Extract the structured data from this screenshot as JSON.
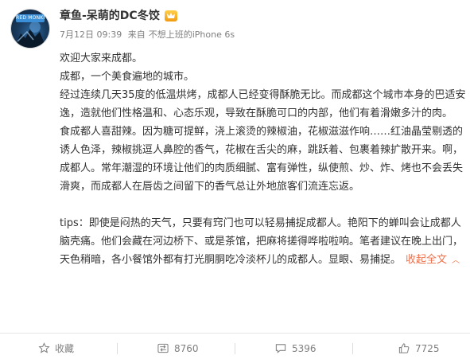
{
  "post": {
    "avatar_tag": "RED MONKEY",
    "username": "章鱼-呆萌的DC冬饺",
    "meta": {
      "date": "7月12日 09:39",
      "source_prefix": "来自",
      "source": "不想上班的iPhone 6s"
    },
    "paragraphs": [
      "欢迎大家来成都。",
      "成都，一个美食遍地的城市。",
      "经过连续几天35度的低温烘烤，成都人已经变得酥脆无比。而成都这个城市本身的巴适安逸，造就他们性格温和、心态乐观，导致在酥脆可口的内部，他们有着滑嫩多汁的肉。",
      "食成都人喜甜辣。因为糖可提鲜，浇上滚烫的辣椒油，花椒滋滋作响……红油晶莹剔透的诱人色泽，辣椒挑逗人鼻腔的香气，花椒在舌尖的麻，跳跃着、包裹着辣扩散开来。啊，成都人。常年潮湿的环境让他们的肉质细腻、富有弹性，纵使煎、炒、炸、烤也不会丢失滑爽，而成都人在唇齿之间留下的香气总让外地旅客们流连忘返。",
      "",
      "tips：即使是闷热的天气，只要有窍门也可以轻易捕捉成都人。艳阳下的蝉叫会让成都人脑壳痛。他们会藏在河边桥下、或是茶馆，把麻将搓得哗啦啦响。笔者建议在晚上出门，天色稍暗，各小餐馆外都有打光胴胴吃冷淡杯儿的成都人。显眼、易捕捉。"
    ],
    "collapse_label": "收起全文"
  },
  "actions": {
    "favorite_label": "收藏",
    "repost_count": "8760",
    "comment_count": "5396",
    "like_count": "7725"
  },
  "colors": {
    "link": "#eb7350",
    "muted": "#808080",
    "text": "#333333"
  }
}
